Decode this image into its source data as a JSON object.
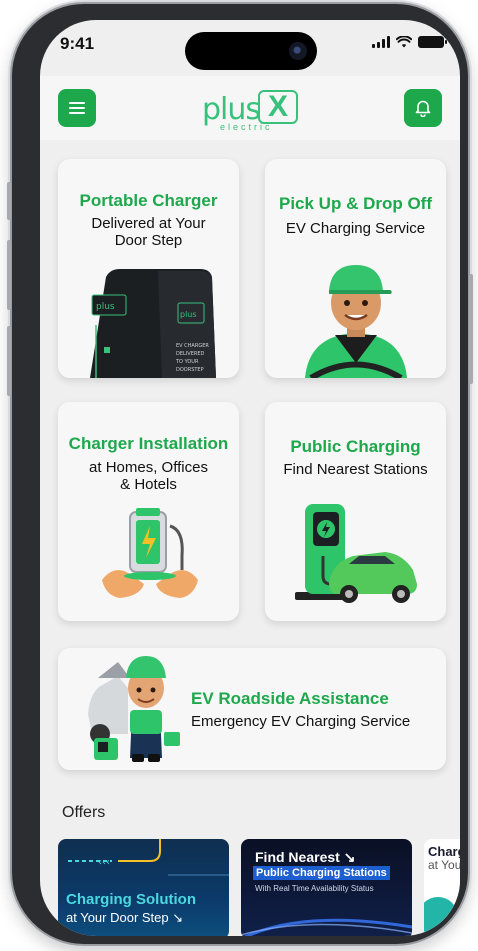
{
  "status_bar": {
    "time": "9:41"
  },
  "header": {
    "logo_main": "plus",
    "logo_mark": "X",
    "logo_sub": "electric"
  },
  "services": [
    {
      "title": "Portable Charger",
      "subtitle_line1": "Delivered at Your",
      "subtitle_line2": "Door Step",
      "charger_label": "EV CHARGER DELIVERED TO YOUR DOORSTEP"
    },
    {
      "title": "Pick Up & Drop Off",
      "subtitle_line1": "EV Charging Service"
    },
    {
      "title": "Charger Installation",
      "subtitle_line1": "at Homes, Offices",
      "subtitle_line2": "& Hotels"
    },
    {
      "title": "Public Charging",
      "subtitle_line1": "Find Nearest Stations"
    },
    {
      "title": "EV Roadside Assistance",
      "subtitle_line1": "Emergency EV Charging Service"
    }
  ],
  "offers": {
    "label": "Offers",
    "items": [
      {
        "line1": "Charging Solution",
        "line2": "at Your Door Step ↘"
      },
      {
        "line1": "Find Nearest ↘",
        "line2": "Public Charging Stations",
        "line3": "With Real Time Availability Status"
      },
      {
        "line1": "Charg",
        "line2": "at You"
      }
    ]
  },
  "colors": {
    "brand_green": "#1ea84c",
    "logo_green": "#39c17c",
    "background": "#efefef"
  },
  "icons": {
    "menu": "hamburger-icon",
    "notifications": "bell-icon"
  }
}
